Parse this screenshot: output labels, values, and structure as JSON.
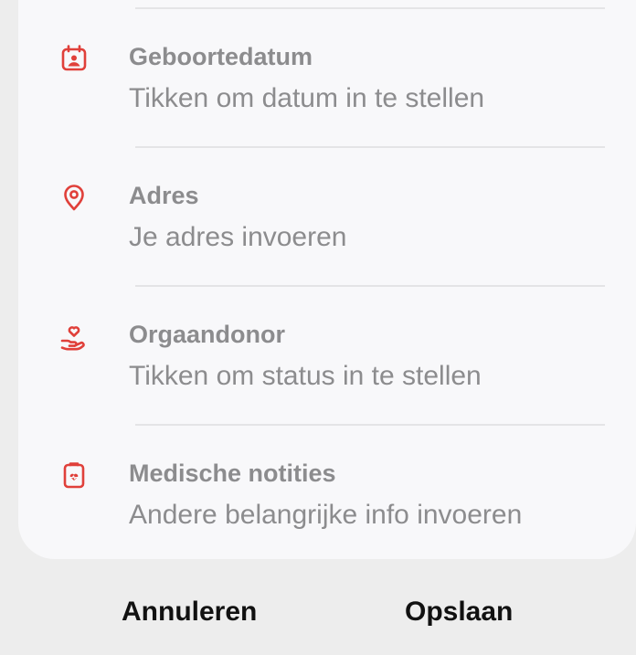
{
  "fields": [
    {
      "title": "Geboortedatum",
      "subtitle": "Tikken om datum in te stellen",
      "icon": "calendar-person-icon"
    },
    {
      "title": "Adres",
      "subtitle": "Je adres invoeren",
      "icon": "location-pin-icon"
    },
    {
      "title": "Orgaandonor",
      "subtitle": "Tikken om status in te stellen",
      "icon": "hand-heart-icon"
    },
    {
      "title": "Medische notities",
      "subtitle": "Andere belangrijke info invoeren",
      "icon": "clipboard-heart-icon"
    }
  ],
  "actions": {
    "cancel_label": "Annuleren",
    "save_label": "Opslaan"
  },
  "colors": {
    "icon_accent": "#e0403a",
    "text_muted": "#8c8c8e",
    "button_text": "#111111",
    "card_bg": "#f8f8fa",
    "page_bg": "#ededed"
  }
}
